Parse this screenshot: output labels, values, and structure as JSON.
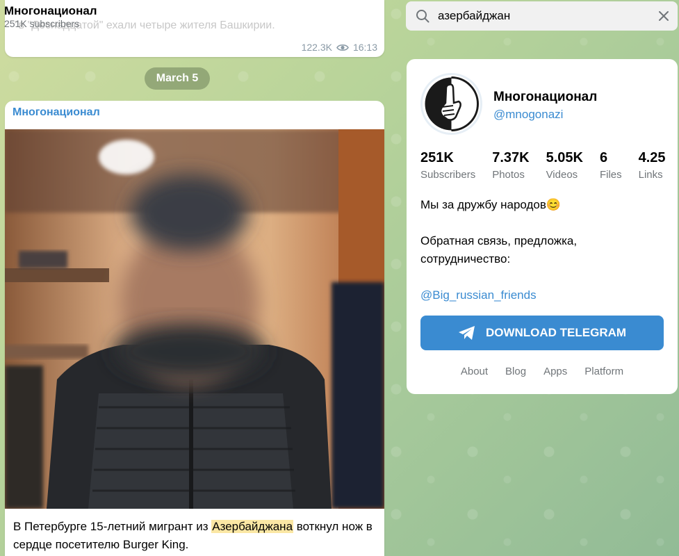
{
  "header": {
    "title": "Многонационал",
    "subscribers": "251K subscribers"
  },
  "prev_message": {
    "text": "\"в \"Деснадцатой\" ехали четыре жителя Башкирии.",
    "views": "122.3K",
    "time": "16:13"
  },
  "date_pill": "March 5",
  "message": {
    "author": "Многонационал",
    "text_before": "В Петербурге 15-летний мигрант из ",
    "highlight": "Азербайджана",
    "text_after": " воткнул нож в сердце посетителю Burger King."
  },
  "search": {
    "query": "азербайджан"
  },
  "channel_card": {
    "title": "Многонационал",
    "handle": "@mnogonazi",
    "stats": [
      {
        "value": "251K",
        "label": "Subscribers"
      },
      {
        "value": "7.37K",
        "label": "Photos"
      },
      {
        "value": "5.05K",
        "label": "Videos"
      },
      {
        "value": "6",
        "label": "Files"
      },
      {
        "value": "4.25",
        "label": "Links"
      }
    ],
    "bio_line1": "Мы за дружбу народов😊",
    "bio_line2": "Обратная связь, предложка, сотрудничество:",
    "bio_link": "@Big_russian_friends",
    "download_button": "DOWNLOAD TELEGRAM",
    "footer_links": [
      "About",
      "Blog",
      "Apps",
      "Platform"
    ]
  },
  "colors": {
    "accent": "#3a8bd1",
    "highlight": "#fbe7a4"
  },
  "icons": [
    "eye-icon",
    "search-icon",
    "close-icon",
    "telegram-plane-icon"
  ]
}
